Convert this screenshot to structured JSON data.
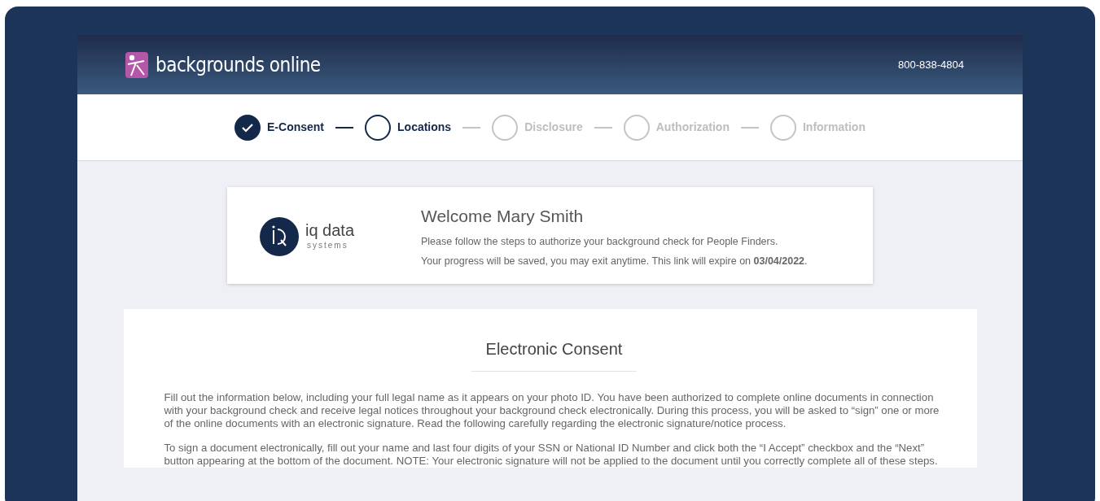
{
  "header": {
    "brand": "backgrounds online",
    "phone": "800-838-4804"
  },
  "steps": [
    {
      "label": "E-Consent",
      "kind": "completed"
    },
    {
      "label": "Locations",
      "kind": "current"
    },
    {
      "label": "Disclosure",
      "kind": "upcoming"
    },
    {
      "label": "Authorization",
      "kind": "upcoming"
    },
    {
      "label": "Information",
      "kind": "upcoming"
    }
  ],
  "welcome": {
    "logo_text": "iq data",
    "logo_subtext": "systems",
    "title": "Welcome Mary Smith",
    "lines": [
      "Please follow the steps to authorize your background check for People Finders.",
      "Your progress will be saved, you may exit anytime. This link will expire on **03/04/2022**."
    ]
  },
  "consent": {
    "title": "Electronic Consent",
    "paragraphs": [
      "Fill out the information below, including your full legal name as it appears on your photo ID. You have been authorized to complete online documents in connection with your background check and receive legal notices throughout your background check electronically. During this process, you will be asked to “sign” one or more of the online documents with an electronic signature. Read the following carefully regarding the electronic signature/notice process.",
      "To sign a document electronically, fill out your name and last four digits of your SSN or National ID Number and click both the “I Accept” checkbox and the “Next” button appearing at the bottom of the document. NOTE: Your electronic signature will not be applied to the document until you correctly complete all of these steps."
    ]
  }
}
